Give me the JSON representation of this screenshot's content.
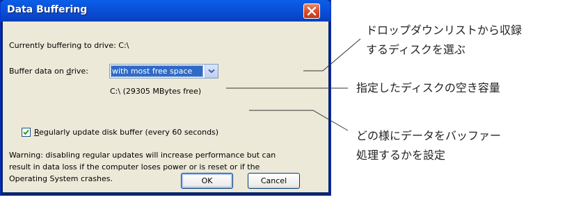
{
  "dialog": {
    "title": "Data Buffering",
    "current_drive_text": "Currently buffering to drive: C:\\",
    "buffer_label_pre": "Buffer data on ",
    "buffer_label_accel": "d",
    "buffer_label_post": "rive:",
    "buffer_dropdown_value": "with most free space",
    "free_space_text": "C:\\ (29305 MBytes free)",
    "checkbox_checked": true,
    "checkbox_label_accel": "R",
    "checkbox_label_rest": "egularly update disk buffer (every 60 seconds)",
    "warning_lines": [
      "Warning: disabling regular updates will increase performance but can",
      "result in data loss if the computer loses power or is reset or if the",
      "Operating System crashes."
    ],
    "ok_label": "OK",
    "cancel_label": "Cancel"
  },
  "callouts": {
    "dropdown_line1": "ドロップダウンリストから収録",
    "dropdown_line2": "するディスクを選ぶ",
    "freespace": "指定したディスクの空き容量",
    "update_line1": "どの様にデータをバッファー",
    "update_line2": "処理するかを設定"
  },
  "colors": {
    "titlebar": "#0a51d8",
    "dialog_face": "#ece9d8",
    "selection": "#316ac5",
    "close_button": "#d64b26"
  }
}
